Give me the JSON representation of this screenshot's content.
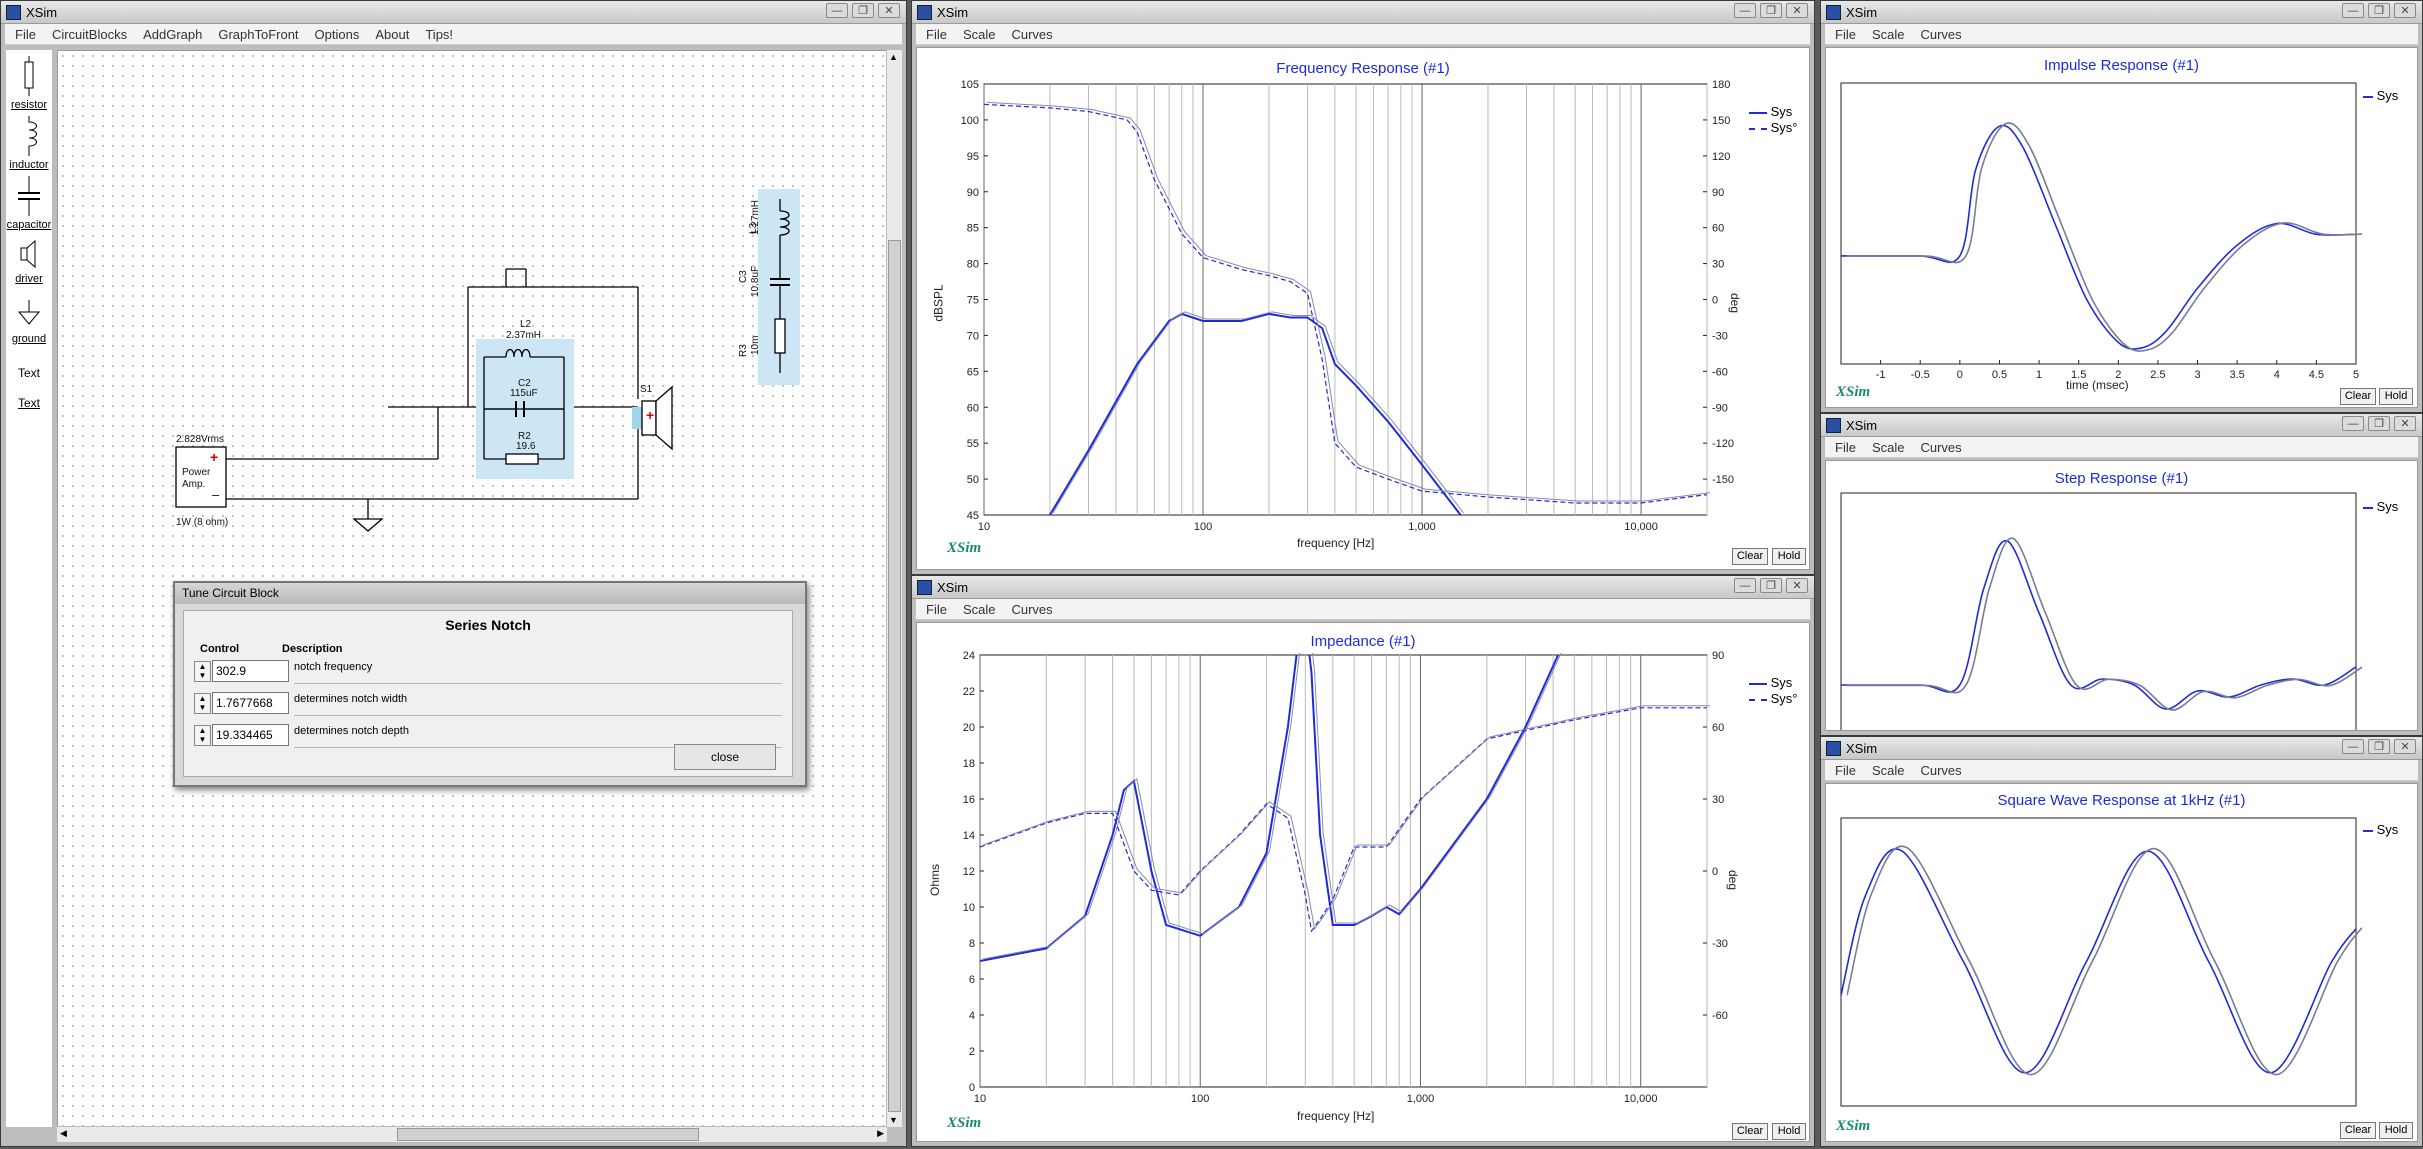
{
  "main_window": {
    "title": "XSim",
    "menu": [
      "File",
      "CircuitBlocks",
      "AddGraph",
      "GraphToFront",
      "Options",
      "About",
      "Tips!"
    ],
    "tools": [
      {
        "label": "resistor",
        "icon": "resistor-icon"
      },
      {
        "label": "inductor",
        "icon": "inductor-icon"
      },
      {
        "label": "capacitor",
        "icon": "capacitor-icon"
      },
      {
        "label": "driver",
        "icon": "driver-icon"
      },
      {
        "label": "ground",
        "icon": "ground-icon"
      },
      {
        "label": "Text",
        "icon": "text-icon"
      },
      {
        "label": "Text",
        "icon": "text-icon"
      }
    ],
    "circuit": {
      "source_voltage": "2.828Vrms",
      "source_name_1": "Power",
      "source_name_2": "Amp.",
      "source_rating": "1W (8 ohm)",
      "L2_name": "L2",
      "L2_value": "2.37mH",
      "C2_name": "C2",
      "C2_value": "115uF",
      "R2_name": "R2",
      "R2_value": "19.6",
      "driver_name": "S1",
      "L3_name": "L3",
      "L3_value": "1.27mH",
      "C3_name": "C3",
      "C3_value": "10.8uF",
      "R3_name": "R3",
      "R3_value": "10m"
    }
  },
  "tune_dialog": {
    "title": "Tune Circuit Block",
    "heading": "Series Notch",
    "col_control": "Control",
    "col_description": "Description",
    "rows": [
      {
        "value": "302.9",
        "description": "notch frequency"
      },
      {
        "value": "1.7677668",
        "description": "determines notch width"
      },
      {
        "value": "19.334465",
        "description": "determines notch depth"
      }
    ],
    "close_label": "close"
  },
  "common": {
    "window_title": "XSim",
    "graph_menu": [
      "File",
      "Scale",
      "Curves"
    ],
    "logo": "XSim",
    "clear_label": "Clear",
    "hold_label": "Hold",
    "minimize": "—",
    "restore": "❐",
    "close": "✕"
  },
  "freq_response": {
    "title": "Frequency Response (#1)",
    "xlabel": "frequency [Hz]",
    "ylabel": "dBSPL",
    "y2label": "deg",
    "legend": [
      "Sys",
      "Sys°"
    ],
    "xticks": [
      "10",
      "100",
      "1,000",
      "10,000"
    ],
    "yticks": [
      "105",
      "100",
      "95",
      "90",
      "85",
      "80",
      "75",
      "70",
      "65",
      "60",
      "55",
      "50",
      "45"
    ],
    "y2ticks": [
      "180",
      "150",
      "120",
      "90",
      "60",
      "30",
      "0",
      "-30",
      "-60",
      "-90",
      "-120",
      "-150"
    ]
  },
  "impedance": {
    "title": "Impedance (#1)",
    "xlabel": "frequency [Hz]",
    "ylabel": "Ohms",
    "y2label": "deg",
    "legend": [
      "Sys",
      "Sys°"
    ],
    "xticks": [
      "10",
      "100",
      "1,000",
      "10,000"
    ],
    "yticks": [
      "24",
      "22",
      "20",
      "18",
      "16",
      "14",
      "12",
      "10",
      "8",
      "6",
      "4",
      "2",
      "0"
    ],
    "y2ticks": [
      "90",
      "60",
      "30",
      "0",
      "-30",
      "-60"
    ]
  },
  "impulse": {
    "title": "Impulse Response (#1)",
    "xlabel": "time (msec)",
    "legend": [
      "Sys"
    ],
    "xticks": [
      "-1",
      "-0.5",
      "0",
      "0.5",
      "1",
      "1.5",
      "2",
      "2.5",
      "3",
      "3.5",
      "4",
      "4.5",
      "5"
    ]
  },
  "step": {
    "title": "Step Response (#1)",
    "legend": [
      "Sys"
    ]
  },
  "square": {
    "title": "Square Wave Response at 1kHz (#1)",
    "legend": [
      "Sys"
    ]
  },
  "chart_data": [
    {
      "type": "line",
      "title": "Frequency Response (#1)",
      "xlabel": "frequency [Hz]",
      "ylabel": "dBSPL",
      "xscale": "log",
      "xlim": [
        10,
        20000
      ],
      "ylim": [
        45,
        105
      ],
      "y2lim": [
        -180,
        180
      ],
      "grid": true,
      "legend": "top-right",
      "series": [
        {
          "name": "Sys",
          "axis": "left",
          "x": [
            10,
            20,
            30,
            50,
            70,
            80,
            100,
            150,
            200,
            250,
            300,
            350,
            400,
            500,
            700,
            1000,
            1500
          ],
          "values": [
            40,
            45,
            54,
            66,
            72,
            73,
            72,
            72,
            73,
            72.5,
            72.5,
            71,
            66,
            63,
            58,
            52,
            45
          ]
        },
        {
          "name": "Sys°",
          "axis": "right",
          "x": [
            10,
            20,
            30,
            40,
            45,
            50,
            60,
            80,
            100,
            150,
            200,
            250,
            300,
            350,
            400,
            500,
            700,
            1000,
            2000,
            5000,
            10000,
            20000
          ],
          "values": [
            163,
            160,
            157,
            152,
            150,
            140,
            100,
            55,
            35,
            25,
            20,
            15,
            5,
            -50,
            -120,
            -140,
            -150,
            -160,
            -165,
            -170,
            -170,
            -163
          ]
        }
      ]
    },
    {
      "type": "line",
      "title": "Impedance (#1)",
      "xlabel": "frequency [Hz]",
      "ylabel": "Ohms",
      "xscale": "log",
      "xlim": [
        10,
        20000
      ],
      "ylim": [
        0,
        24
      ],
      "y2lim": [
        -90,
        90
      ],
      "grid": true,
      "legend": "top-right",
      "series": [
        {
          "name": "Sys",
          "axis": "left",
          "x": [
            10,
            20,
            30,
            40,
            45,
            50,
            60,
            70,
            100,
            150,
            200,
            250,
            280,
            300,
            320,
            350,
            400,
            500,
            600,
            700,
            800,
            1000,
            2000,
            3000,
            5000
          ],
          "values": [
            7,
            7.7,
            9.5,
            14,
            16.5,
            17,
            12,
            9,
            8.4,
            10,
            13,
            20,
            25,
            26,
            23,
            14,
            9,
            9,
            9.5,
            10,
            9.6,
            11,
            16,
            20,
            26
          ]
        },
        {
          "name": "Sys°",
          "axis": "right",
          "x": [
            10,
            20,
            30,
            40,
            50,
            60,
            80,
            100,
            150,
            200,
            250,
            300,
            320,
            350,
            400,
            500,
            700,
            1000,
            2000,
            5000,
            10000,
            20000
          ],
          "values": [
            10,
            20,
            24,
            24,
            0,
            -8,
            -10,
            0,
            15,
            28,
            22,
            -10,
            -25,
            -20,
            -12,
            10,
            10,
            30,
            55,
            63,
            68,
            68
          ]
        }
      ]
    },
    {
      "type": "line",
      "title": "Impulse Response (#1)",
      "xlabel": "time (msec)",
      "xlim": [
        -1.5,
        5
      ],
      "ylim": [
        -1,
        1.6
      ],
      "grid": false,
      "legend": "top-right",
      "series": [
        {
          "name": "Sys",
          "x": [
            -1.5,
            -0.5,
            0,
            0.2,
            0.5,
            0.8,
            1.2,
            1.6,
            2.0,
            2.3,
            2.6,
            3.0,
            3.5,
            4.0,
            4.5,
            5.0
          ],
          "values": [
            0,
            0,
            0,
            0.8,
            1.2,
            1.0,
            0.3,
            -0.4,
            -0.8,
            -0.85,
            -0.7,
            -0.3,
            0.1,
            0.3,
            0.2,
            0.2
          ]
        }
      ]
    },
    {
      "type": "line",
      "title": "Step Response (#1)",
      "xlim": [
        -1.5,
        5
      ],
      "ylim": [
        -0.4,
        1.6
      ],
      "grid": false,
      "legend": "top-right",
      "series": [
        {
          "name": "Sys",
          "x": [
            -1.5,
            -0.5,
            0,
            0.3,
            0.6,
            1.0,
            1.4,
            1.8,
            2.2,
            2.6,
            3.0,
            3.4,
            3.8,
            4.2,
            4.6,
            5.0
          ],
          "values": [
            0,
            0,
            0,
            0.8,
            1.2,
            0.6,
            0,
            0.05,
            0,
            -0.2,
            -0.05,
            -0.1,
            0,
            0.05,
            0,
            0.15
          ]
        }
      ]
    },
    {
      "type": "line",
      "title": "Square Wave Response at 1kHz (#1)",
      "xlim": [
        0,
        2.1
      ],
      "ylim": [
        -1.3,
        1.3
      ],
      "grid": false,
      "legend": "top-right",
      "series": [
        {
          "name": "Sys",
          "x": [
            0,
            0.1,
            0.25,
            0.5,
            0.75,
            1.0,
            1.25,
            1.5,
            1.75,
            2.0,
            2.1
          ],
          "values": [
            -0.3,
            0.6,
            1.0,
            0,
            -1.0,
            0,
            1.0,
            0,
            -1.0,
            0,
            0.3
          ]
        }
      ]
    }
  ]
}
